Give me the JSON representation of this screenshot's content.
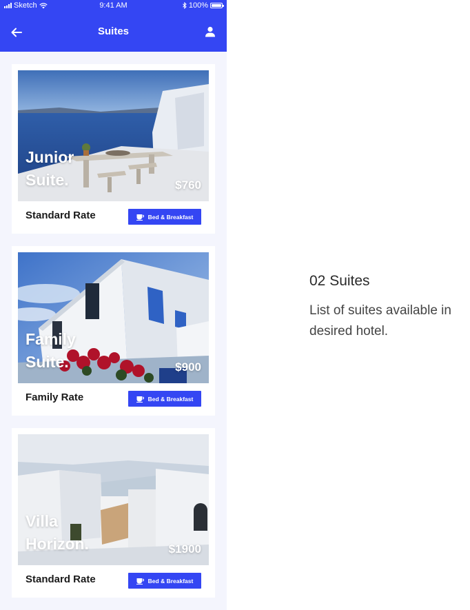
{
  "status_bar": {
    "carrier": "Sketch",
    "time": "9:41 AM",
    "battery": "100%"
  },
  "nav": {
    "title": "Suites",
    "back_icon": "arrow-left-icon",
    "profile_icon": "user-icon"
  },
  "suites": [
    {
      "name": "Junior\nSuite.",
      "price": "$760",
      "rate": "Standard Rate",
      "badge": "Bed & Breakfast"
    },
    {
      "name": "Family\nSuite.",
      "price": "$900",
      "rate": "Family Rate",
      "badge": "Bed & Breakfast"
    },
    {
      "name": "Villa\nHorizon.",
      "price": "$1900",
      "rate": "Standard Rate",
      "badge": "Bed & Breakfast"
    }
  ],
  "side": {
    "title": "02 Suites",
    "description": "List of suites available in desired hotel."
  },
  "colors": {
    "accent": "#3446f3",
    "background": "#f4f5fd"
  }
}
